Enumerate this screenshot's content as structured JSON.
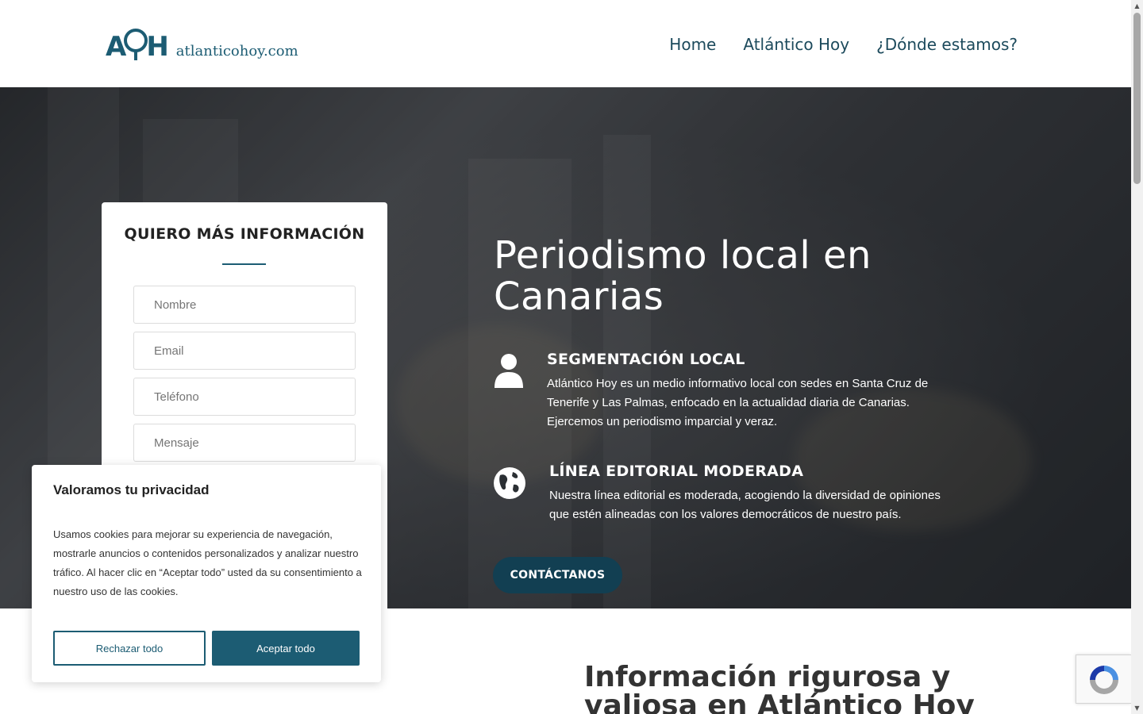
{
  "header": {
    "logo_mark_left": "A",
    "logo_mark_right": "H",
    "logo_text": "atlanticohoy.com",
    "nav": [
      "Home",
      "Atlántico Hoy",
      "¿Dónde estamos?"
    ]
  },
  "form": {
    "title": "QUIERO MÁS INFORMACIÓN",
    "fields": {
      "name_placeholder": "Nombre",
      "email_placeholder": "Email",
      "phone_placeholder": "Teléfono",
      "message_placeholder": "Mensaje"
    }
  },
  "hero": {
    "title": "Periodismo local en Canarias",
    "features": [
      {
        "icon": "user-icon",
        "title": "SEGMENTACIÓN LOCAL",
        "text": "Atlántico Hoy es un medio informativo local con sedes en Santa Cruz de Tenerife y Las Palmas, enfocado en la actualidad diaria de Canarias. Ejercemos un periodismo imparcial y veraz."
      },
      {
        "icon": "globe-icon",
        "title": "LÍNEA EDITORIAL MODERADA",
        "text": "Nuestra línea editorial es moderada, acogiendo la diversidad de opiniones que estén alineadas con los valores democráticos de nuestro país."
      }
    ],
    "cta_label": "CONTÁCTANOS"
  },
  "section": {
    "title": "Información rigurosa y valiosa en Atlántico Hoy"
  },
  "cookie": {
    "title": "Valoramos tu privacidad",
    "text": "Usamos cookies para mejorar su experiencia de navegación, mostrarle anuncios o contenidos personalizados y analizar nuestro tráfico. Al hacer clic en “Aceptar todo” usted da su consentimiento a nuestro uso de las cookies.",
    "reject_label": "Rechazar todo",
    "accept_label": "Aceptar todo"
  },
  "colors": {
    "brand": "#1c5c73",
    "cta": "#123f52"
  }
}
